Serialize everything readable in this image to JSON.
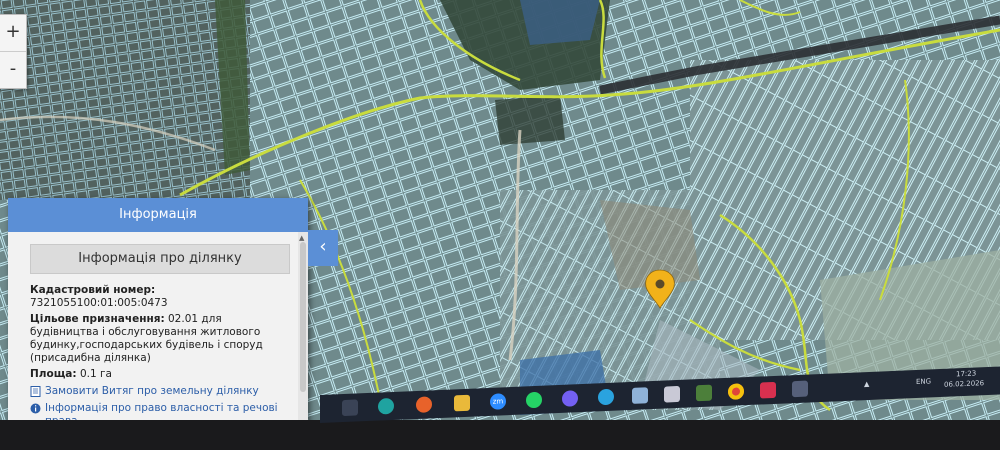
{
  "map": {
    "zoom_in_label": "+",
    "zoom_out_label": "-",
    "colors": {
      "imagery": "#5f6d6a",
      "parcel": "#bfe3ee",
      "boundary": "#d9e84a",
      "marker": "#f2b21a"
    }
  },
  "panel": {
    "title": "Інформація",
    "subtitle": "Інформація про ділянку",
    "cadastral_label": "Кадастровий номер:",
    "cadastral_value": "7321055100:01:005:0473",
    "purpose_label": "Цільове призначення:",
    "purpose_value": "02.01 для будівництва і обслуговування житлового будинку,господарських будівель і споруд (присадибна ділянка)",
    "area_label": "Площа:",
    "area_value": "0.1 га",
    "link_extract": "Замовити Витяг про земельну ділянку",
    "link_rights": "Інформація про право власності та речові права",
    "collapse_icon": "‹"
  },
  "taskbar": {
    "apps": [
      "task-view",
      "edge",
      "firefox",
      "file-explorer",
      "zoom",
      "whatsapp",
      "viber",
      "telegram",
      "notepad",
      "store",
      "xbox",
      "chrome",
      "app-red",
      "app-settings"
    ],
    "zoom_label": "zm",
    "language": "ENG",
    "time": "17:23",
    "date": "06.02.2026"
  }
}
